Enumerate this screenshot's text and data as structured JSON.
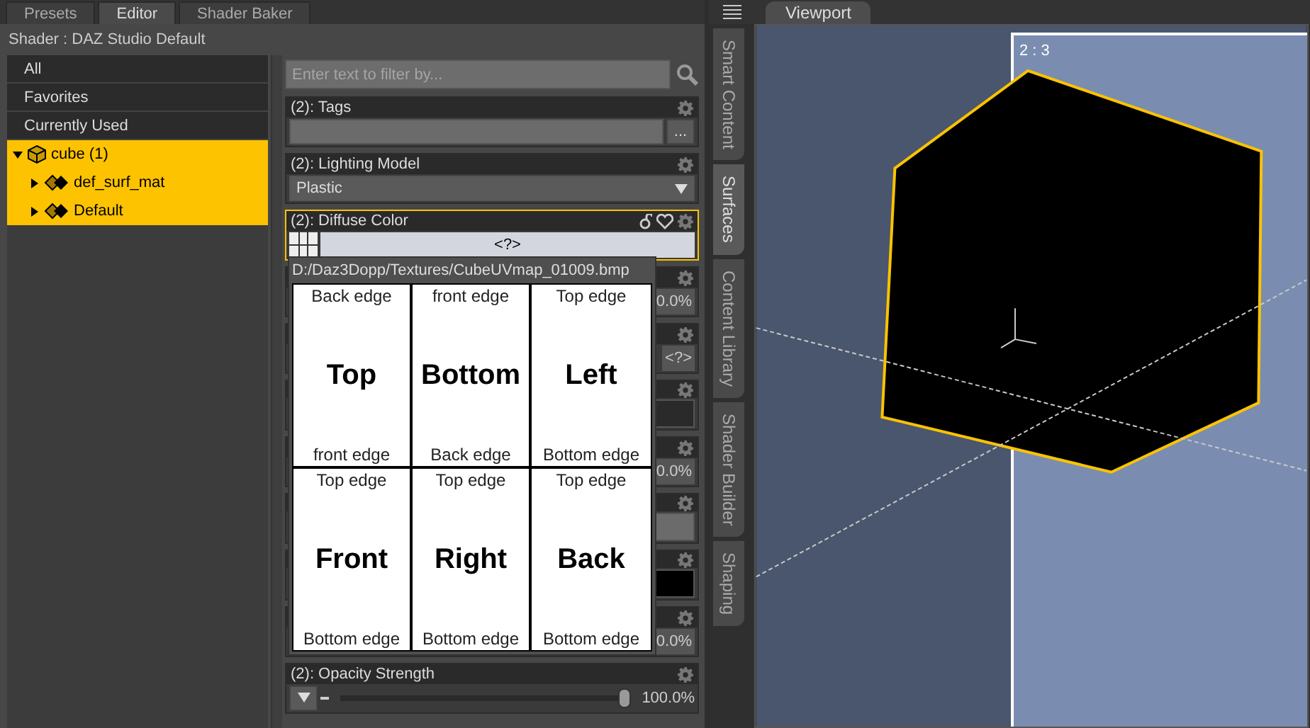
{
  "left_tabs": [
    {
      "label": "Presets",
      "selected": false
    },
    {
      "label": "Editor",
      "selected": true
    },
    {
      "label": "Shader Baker",
      "selected": false
    }
  ],
  "shader_label": "Shader : DAZ Studio Default",
  "filters": [
    {
      "label": "All"
    },
    {
      "label": "Favorites"
    },
    {
      "label": "Currently Used"
    }
  ],
  "tree": [
    {
      "label": "cube (1)",
      "kind": "object",
      "expanded": true,
      "selected": true,
      "children": [
        {
          "label": "def_surf_mat",
          "kind": "material",
          "expanded": false,
          "selected": true
        },
        {
          "label": "Default",
          "kind": "material",
          "expanded": false,
          "selected": true
        }
      ]
    }
  ],
  "filter_field": {
    "placeholder": "Enter text to filter by..."
  },
  "properties": [
    {
      "kind": "text",
      "title": "(2): Tags",
      "button": "...",
      "highlighted": false
    },
    {
      "kind": "dropdown",
      "title": "(2): Lighting Model",
      "value": "Plastic",
      "highlighted": false
    },
    {
      "kind": "color",
      "title": "(2): Diffuse Color",
      "value": "<?>",
      "highlighted": true
    },
    {
      "kind": "percent",
      "reading": "0.0%",
      "highlighted": false
    },
    {
      "kind": "field",
      "value": "<?>",
      "highlighted": false
    },
    {
      "kind": "swatch",
      "color": "#2a2a2a",
      "highlighted": false
    },
    {
      "kind": "percent",
      "reading": "0.0%",
      "highlighted": false
    },
    {
      "kind": "swatch",
      "color": "#6b6b6b",
      "highlighted": false
    },
    {
      "kind": "swatch",
      "color": "#000000",
      "highlighted": false
    },
    {
      "kind": "percent",
      "reading": "0.0%",
      "highlighted": false
    },
    {
      "kind": "slider",
      "title": "(2): Opacity Strength",
      "level": 1.0,
      "reading": "100.0%",
      "highlighted": false
    }
  ],
  "tooltip": {
    "path": "D:/Daz3Dopp/Textures/CubeUVmap_01009.bmp",
    "faces": [
      {
        "top": "Back edge",
        "name": "Top",
        "bottom": "front edge"
      },
      {
        "top": "front edge",
        "name": "Bottom",
        "bottom": "Back edge"
      },
      {
        "top": "Top edge",
        "name": "Left",
        "bottom": "Bottom edge"
      },
      {
        "top": "Top edge",
        "name": "Front",
        "bottom": "Bottom edge"
      },
      {
        "top": "Top edge",
        "name": "Right",
        "bottom": "Bottom edge"
      },
      {
        "top": "Top edge",
        "name": "Back",
        "bottom": "Bottom edge"
      }
    ]
  },
  "side_tabs": [
    {
      "label": "Smart Content",
      "selected": false
    },
    {
      "label": "Surfaces",
      "selected": true
    },
    {
      "label": "Content Library",
      "selected": false
    },
    {
      "label": "Shader Builder",
      "selected": false
    },
    {
      "label": "Shaping",
      "selected": false
    }
  ],
  "viewport": {
    "tab": "Viewport",
    "camera_label": "2 : 3"
  }
}
